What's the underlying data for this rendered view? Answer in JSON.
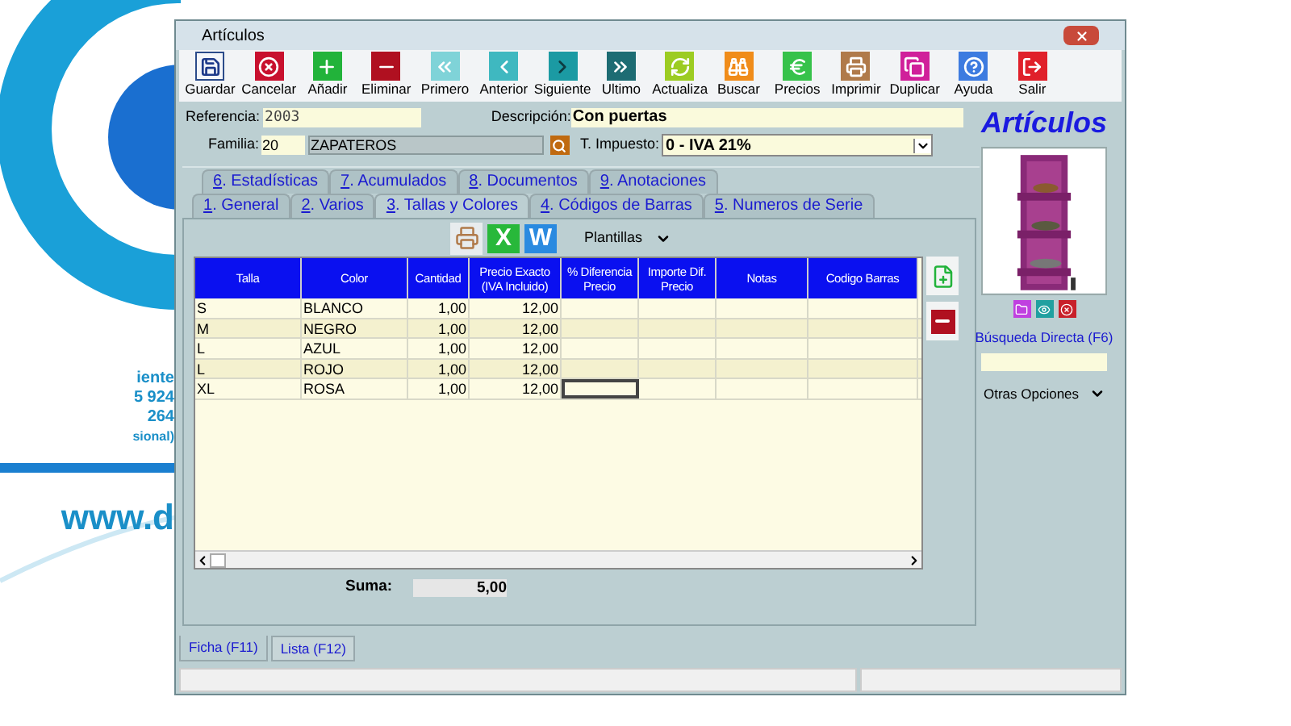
{
  "backdrop": {
    "lines": [
      "iente",
      "5 924",
      "264",
      "sional)"
    ],
    "url": "www.d"
  },
  "window": {
    "title": "Artículos"
  },
  "toolbar": [
    {
      "label": "Guardar",
      "kind": "save"
    },
    {
      "label": "Cancelar",
      "kind": "cancel"
    },
    {
      "label": "Añadir",
      "kind": "add"
    },
    {
      "label": "Eliminar",
      "kind": "delete"
    },
    {
      "label": "Primero",
      "kind": "first"
    },
    {
      "label": "Anterior",
      "kind": "prev"
    },
    {
      "label": "Siguiente",
      "kind": "next"
    },
    {
      "label": "Ultimo",
      "kind": "last"
    },
    {
      "label": "Actualiza",
      "kind": "refresh"
    },
    {
      "label": "Buscar",
      "kind": "search"
    },
    {
      "label": "Precios",
      "kind": "prices"
    },
    {
      "label": "Imprimir",
      "kind": "print"
    },
    {
      "label": "Duplicar",
      "kind": "copy"
    },
    {
      "label": "Ayuda",
      "kind": "help"
    },
    {
      "label": "Salir",
      "kind": "exit"
    }
  ],
  "form": {
    "referencia": {
      "label": "Referencia:",
      "value": "2003"
    },
    "descripcion": {
      "label": "Descripción:",
      "value": "Con puertas"
    },
    "familia": {
      "label": "Familia:",
      "code": "20",
      "name": "ZAPATEROS"
    },
    "impuesto": {
      "label": "T. Impuesto:",
      "value": "0 - IVA 21%"
    }
  },
  "tabs_top": [
    {
      "label": "6. Estadísticas",
      "selected": false
    },
    {
      "label": "7. Acumulados",
      "selected": false
    },
    {
      "label": "8. Documentos",
      "selected": false
    },
    {
      "label": "9. Anotaciones",
      "selected": false
    }
  ],
  "tabs": [
    {
      "label": "1. General",
      "selected": false
    },
    {
      "label": "2. Varios",
      "selected": false
    },
    {
      "label": "3. Tallas y Colores",
      "selected": true
    },
    {
      "label": "4. Códigos de Barras",
      "selected": false
    },
    {
      "label": "5. Numeros de Serie",
      "selected": false
    }
  ],
  "grid_toolbar": {
    "excel": "X",
    "word": "W",
    "templates": "Plantillas"
  },
  "table": {
    "columns": [
      "Talla",
      "Color",
      "Cantidad",
      "Precio Exacto (IVA Incluido)",
      "% Diferencia Precio",
      "Importe Dif. Precio",
      "Notas",
      "Codigo Barras"
    ],
    "rows": [
      {
        "cells": [
          "S",
          "BLANCO",
          "1,00",
          "12,00",
          "",
          "",
          "",
          ""
        ],
        "focused": false
      },
      {
        "cells": [
          "M",
          "NEGRO",
          "1,00",
          "12,00",
          "",
          "",
          "",
          ""
        ],
        "focused": false
      },
      {
        "cells": [
          "L",
          "AZUL",
          "1,00",
          "12,00",
          "",
          "",
          "",
          ""
        ],
        "focused": false
      },
      {
        "cells": [
          "L",
          "ROJO",
          "1,00",
          "12,00",
          "",
          "",
          "",
          ""
        ],
        "focused": false
      },
      {
        "cells": [
          "XL",
          "ROSA",
          "1,00",
          "12,00",
          "",
          "",
          "",
          ""
        ],
        "focused": true
      }
    ]
  },
  "sum": {
    "label": "Suma:",
    "value": "5,00"
  },
  "side": {
    "heading": "Artículos",
    "search_link": "Búsqueda Directa (F6)",
    "more": "Otras Opciones"
  },
  "bottom_tabs": [
    {
      "label": "Ficha (F11)",
      "selected": true
    },
    {
      "label": "Lista (F12)",
      "selected": false
    }
  ]
}
